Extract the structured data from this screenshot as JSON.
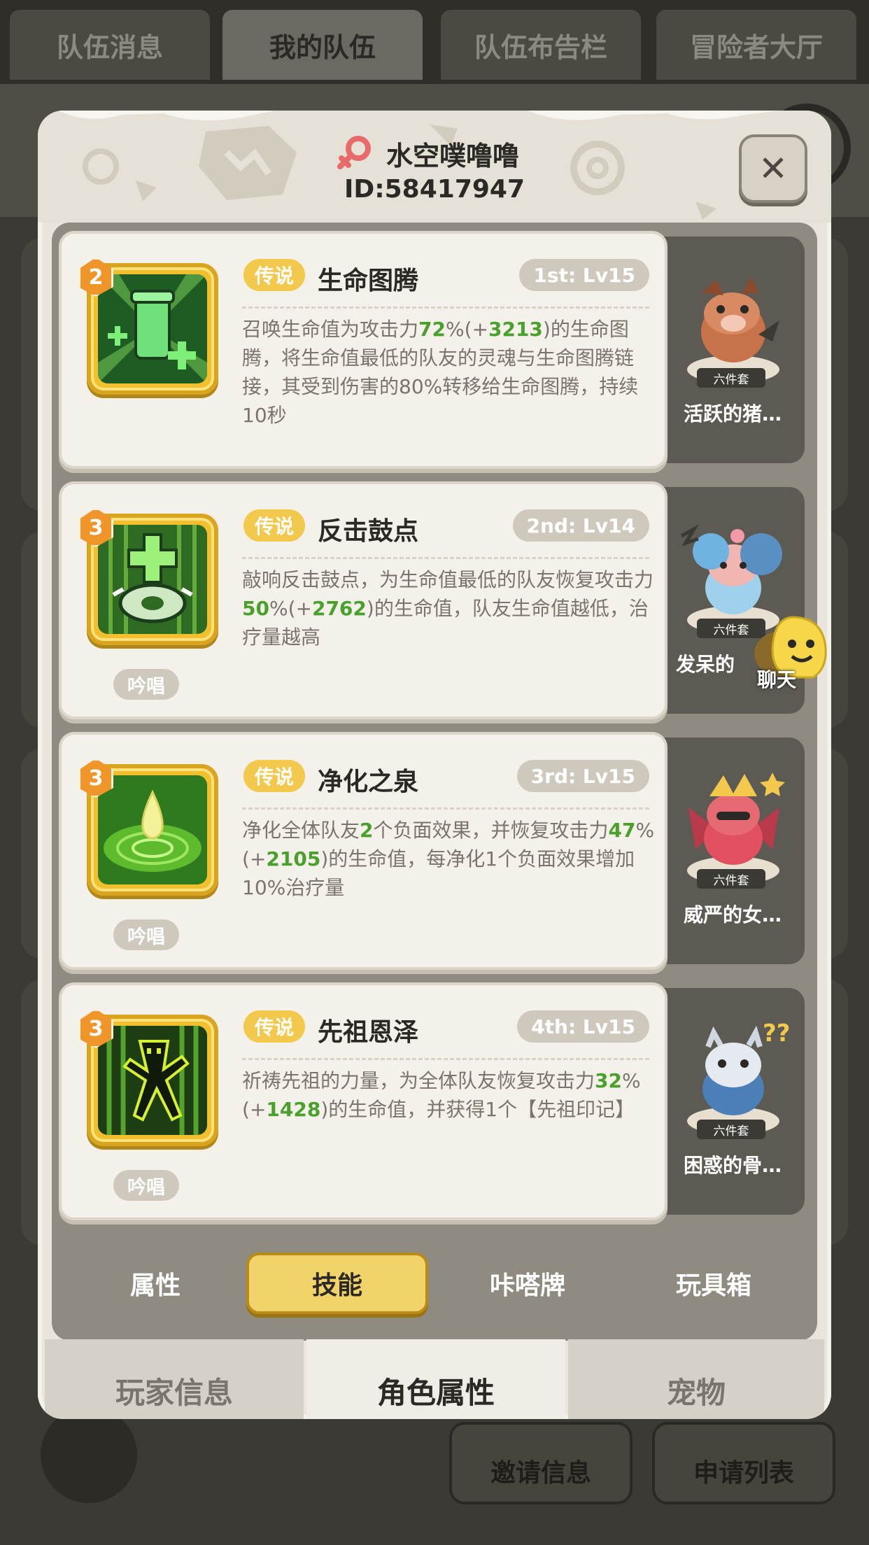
{
  "top_tabs": [
    "队伍消息",
    "我的队伍",
    "队伍布告栏",
    "冒险者大厅"
  ],
  "top_tabs_active": 1,
  "background_buttons": {
    "invite": "邀请信息",
    "apply": "申请列表"
  },
  "player": {
    "name": "水空噗噜噜",
    "id": "ID:58417947",
    "gender": "female"
  },
  "close_label": "✕",
  "skills": [
    {
      "level": "2",
      "rarity": "传说",
      "name": "生命图腾",
      "rank": "1st: Lv15",
      "desc_parts": [
        {
          "t": "召唤生命值为攻击力"
        },
        {
          "t": "72",
          "hl": true
        },
        {
          "t": "%(+"
        },
        {
          "t": "3213",
          "hl": true
        },
        {
          "t": ")的生命图腾，将生命值最低的队友的灵魂与生命图腾链接，其受到伤害的80%转移给生命图腾，持续10秒"
        }
      ],
      "chant": "",
      "pet": {
        "set": "六件套",
        "name": "活跃的猪…"
      },
      "icon": "life-totem-icon"
    },
    {
      "level": "3",
      "rarity": "传说",
      "name": "反击鼓点",
      "rank": "2nd: Lv14",
      "desc_parts": [
        {
          "t": "敲响反击鼓点，为生命值最低的队友恢复攻击力"
        },
        {
          "t": "50",
          "hl": true
        },
        {
          "t": "%(+"
        },
        {
          "t": "2762",
          "hl": true
        },
        {
          "t": ")的生命值，队友生命值越低，治疗量越高"
        }
      ],
      "chant": "吟唱",
      "pet": {
        "set": "六件套",
        "name": "发呆的"
      },
      "icon": "counter-drum-icon"
    },
    {
      "level": "3",
      "rarity": "传说",
      "name": "净化之泉",
      "rank": "3rd: Lv15",
      "desc_parts": [
        {
          "t": "净化全体队友"
        },
        {
          "t": "2",
          "hl": true
        },
        {
          "t": "个负面效果，并恢复攻击力"
        },
        {
          "t": "47",
          "hl": true
        },
        {
          "t": "%(+"
        },
        {
          "t": "2105",
          "hl": true
        },
        {
          "t": ")的生命值，每净化1个负面效果增加10%治疗量"
        }
      ],
      "chant": "吟唱",
      "pet": {
        "set": "六件套",
        "name": "威严的女…"
      },
      "icon": "purify-spring-icon"
    },
    {
      "level": "3",
      "rarity": "传说",
      "name": "先祖恩泽",
      "rank": "4th: Lv15",
      "desc_parts": [
        {
          "t": "祈祷先祖的力量，为全体队友恢复攻击力"
        },
        {
          "t": "32",
          "hl": true
        },
        {
          "t": "%(+"
        },
        {
          "t": "1428",
          "hl": true
        },
        {
          "t": ")的生命值，并获得1个【先祖印记】"
        }
      ],
      "chant": "吟唱",
      "pet": {
        "set": "六件套",
        "name": "困惑的骨…"
      },
      "icon": "ancestor-blessing-icon"
    }
  ],
  "segment_tabs": [
    "属性",
    "技能",
    "咔嗒牌",
    "玩具箱"
  ],
  "segment_active": 1,
  "bottom_tabs": [
    "玩家信息",
    "角色属性",
    "宠物"
  ],
  "bottom_active": 1,
  "chat_label": "聊天",
  "colors": {
    "highlight_green": "#4aa02c",
    "rarity_gold": "#f2c94c",
    "icon_frame": "#f2bf2e"
  }
}
